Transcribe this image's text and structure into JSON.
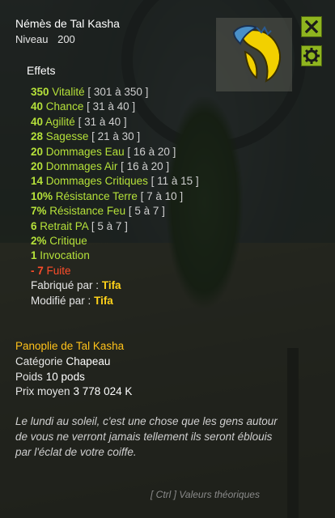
{
  "item": {
    "name": "Némès de Tal Kasha",
    "level_label": "Niveau",
    "level": "200"
  },
  "effects_heading": "Effets",
  "effects": [
    {
      "value": "350",
      "name": "Vitalité",
      "range": "[ 301 à 350 ]"
    },
    {
      "value": "40",
      "name": "Chance",
      "range": "[ 31 à 40 ]"
    },
    {
      "value": "40",
      "name": "Agilité",
      "range": "[ 31 à 40 ]"
    },
    {
      "value": "28",
      "name": "Sagesse",
      "range": "[ 21 à 30 ]"
    },
    {
      "value": "20",
      "name": "Dommages Eau",
      "range": "[ 16 à 20 ]"
    },
    {
      "value": "20",
      "name": "Dommages Air",
      "range": "[ 16 à 20 ]"
    },
    {
      "value": "14",
      "name": "Dommages Critiques",
      "range": "[ 11 à 15 ]"
    },
    {
      "value": "10%",
      "name": "Résistance Terre",
      "range": "[ 7 à 10 ]"
    },
    {
      "value": "7%",
      "name": "Résistance Feu",
      "range": "[ 5 à 7 ]"
    },
    {
      "value": "6",
      "name": "Retrait PA",
      "range": "[ 5 à 7 ]"
    },
    {
      "value": "2%",
      "name": "Critique",
      "range": ""
    },
    {
      "value": "1",
      "name": "Invocation",
      "range": ""
    }
  ],
  "malus": {
    "value": "- 7",
    "name": "Fuite"
  },
  "crafted_by": {
    "label": "Fabriqué par :",
    "name": "Tifa"
  },
  "modified_by": {
    "label": "Modifié par :",
    "name": "Tifa"
  },
  "set_name": "Panoplie de Tal Kasha",
  "category": {
    "label": "Catégorie",
    "value": "Chapeau"
  },
  "weight": {
    "label": "Poids",
    "value": "10 pods"
  },
  "price": {
    "label": "Prix moyen",
    "value": "3 778 024 K"
  },
  "description": "Le lundi au soleil, c'est une chose que les gens autour de vous ne verront jamais tellement ils seront éblouis par l'éclat de votre coiffe.",
  "footer_hint": "[ Ctrl ] Valeurs théoriques",
  "icons": {
    "close": "close-icon",
    "settings": "gear-icon",
    "item": "nemes-helmet-icon"
  },
  "colors": {
    "bonus": "#b6e23a",
    "malus": "#ff4d2a",
    "set": "#ffc21a",
    "button": "#8fb51f"
  }
}
